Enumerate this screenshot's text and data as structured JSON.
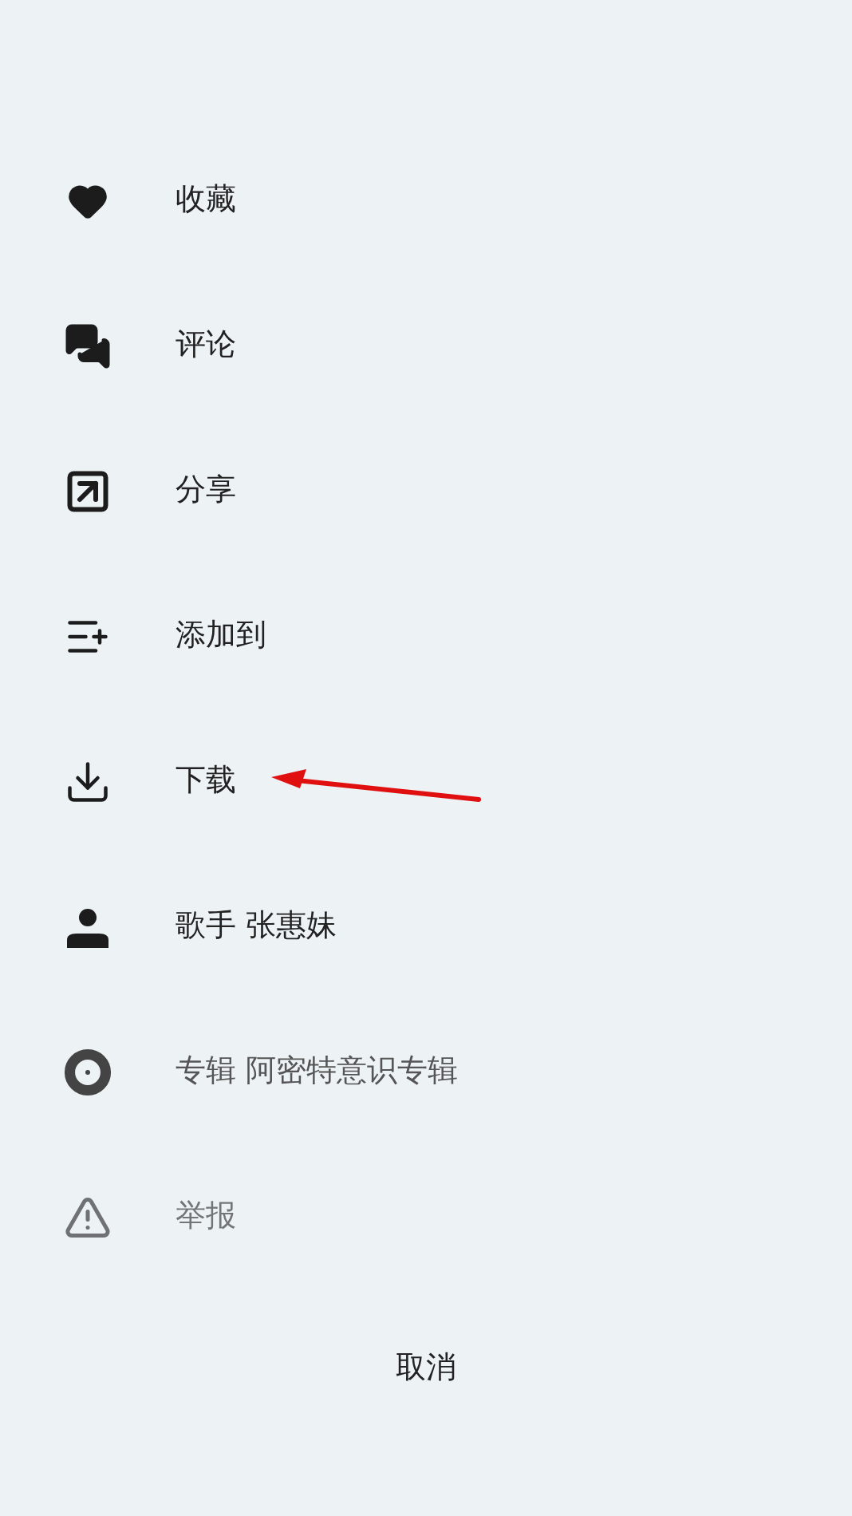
{
  "menu_items": [
    {
      "kind": "favorite",
      "label": "收藏",
      "faded": false
    },
    {
      "kind": "comment",
      "label": "评论",
      "faded": false
    },
    {
      "kind": "share",
      "label": "分享",
      "faded": false
    },
    {
      "kind": "add_to",
      "label": "添加到",
      "faded": false
    },
    {
      "kind": "download",
      "label": "下载",
      "faded": false
    },
    {
      "kind": "artist",
      "label": "歌手 张惠妹",
      "faded": false
    },
    {
      "kind": "album",
      "label": "专辑 阿密特意识专辑",
      "faded": false
    },
    {
      "kind": "report",
      "label": "举报",
      "faded": true
    }
  ],
  "cancel_button": "取消"
}
